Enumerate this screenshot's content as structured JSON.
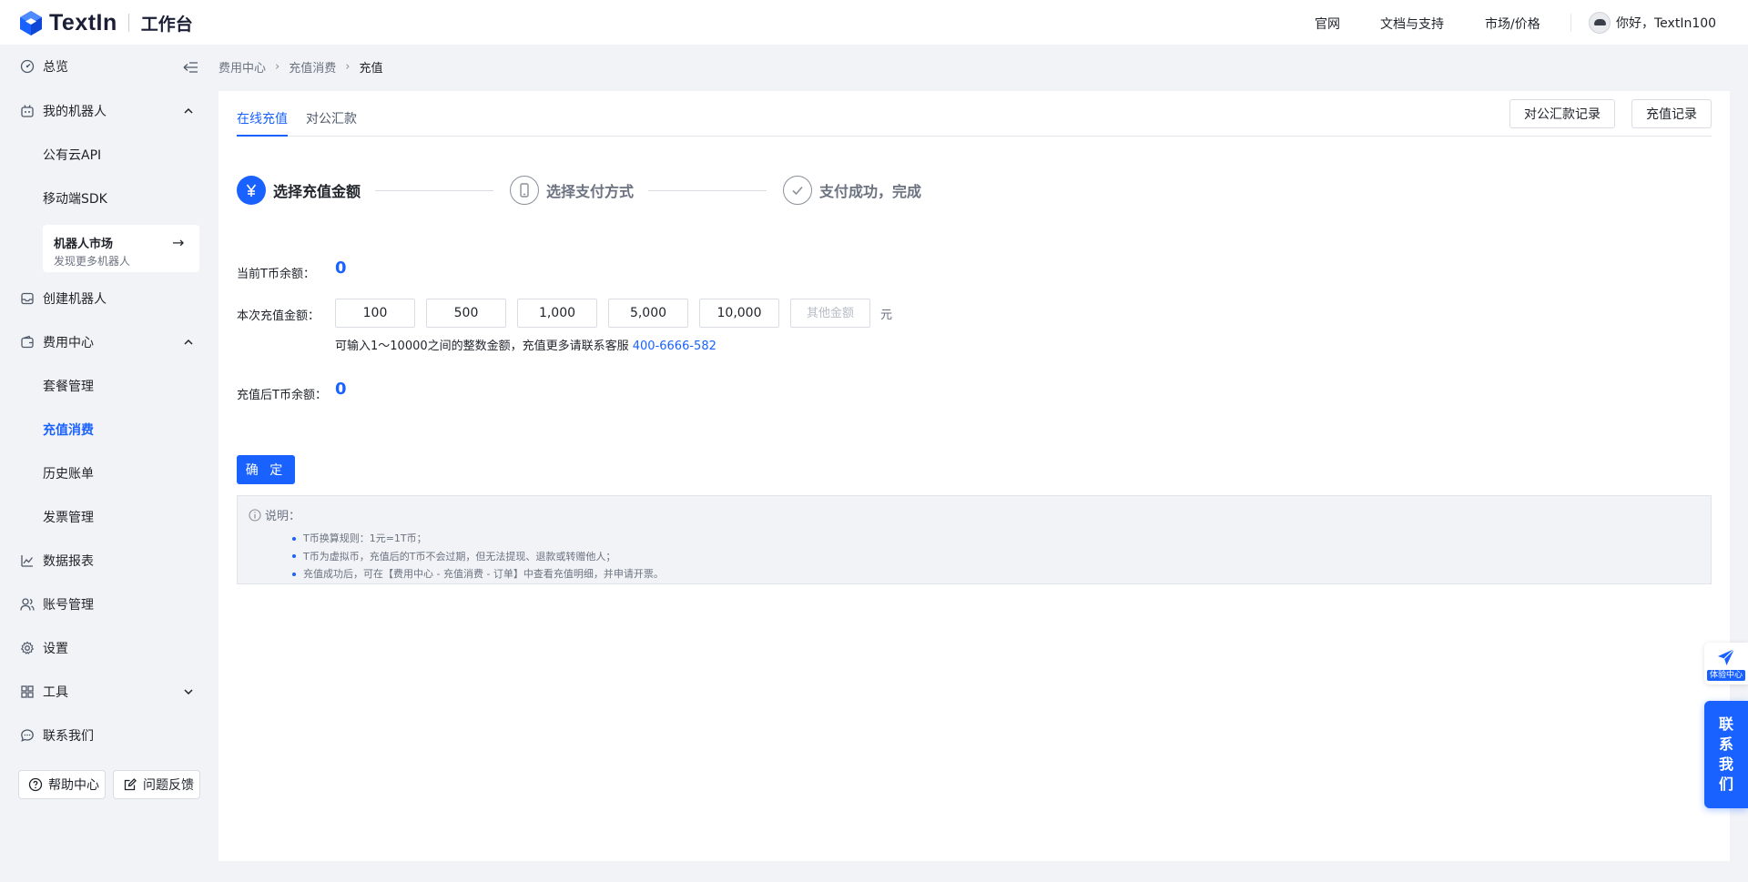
{
  "header": {
    "logo_text": "TextIn",
    "workspace": "工作台",
    "nav": [
      "官网",
      "文档与支持",
      "市场/价格"
    ],
    "user_greeting": "你好，TextIn100"
  },
  "sidebar": {
    "items": [
      {
        "label": "总览",
        "icon": "dashboard-icon"
      },
      {
        "label": "我的机器人",
        "icon": "robot-icon"
      },
      {
        "label": "公有云API"
      },
      {
        "label": "移动端SDK"
      },
      {
        "label": "创建机器人",
        "icon": "inbox-icon"
      },
      {
        "label": "费用中心",
        "icon": "wallet-icon"
      },
      {
        "label": "套餐管理"
      },
      {
        "label": "充值消费"
      },
      {
        "label": "历史账单"
      },
      {
        "label": "发票管理"
      },
      {
        "label": "数据报表",
        "icon": "chart-icon"
      },
      {
        "label": "账号管理",
        "icon": "users-icon"
      },
      {
        "label": "设置",
        "icon": "gear-icon"
      },
      {
        "label": "工具",
        "icon": "grid-icon"
      },
      {
        "label": "联系我们",
        "icon": "chat-icon"
      }
    ],
    "market": {
      "title": "机器人市场",
      "subtitle": "发现更多机器人"
    },
    "help_center": "帮助中心",
    "feedback": "问题反馈"
  },
  "breadcrumb": [
    "费用中心",
    "充值消费",
    "充值"
  ],
  "tabs": [
    "在线充值",
    "对公汇款"
  ],
  "actions": {
    "remittance_records": "对公汇款记录",
    "recharge_records": "充值记录"
  },
  "steps": [
    "选择充值金额",
    "选择支付方式",
    "支付成功，完成"
  ],
  "form": {
    "balance_label": "当前T币余额：",
    "balance_value": "0",
    "amount_label": "本次充值金额：",
    "amount_options": [
      "100",
      "500",
      "1,000",
      "5,000",
      "10,000"
    ],
    "other_placeholder": "其他金额",
    "unit": "元",
    "hint_text": "可输入1～10000之间的整数金额，充值更多请联系客服 ",
    "hint_phone": "400-6666-582",
    "after_label": "充值后T币余额：",
    "after_value": "0",
    "confirm": "确 定"
  },
  "notes": {
    "title": "说明：",
    "items": [
      "T币换算规则：1元=1T币；",
      "T币为虚拟币，充值后的T币不会过期，但无法提现、退款或转赠他人；",
      "充值成功后，可在【费用中心 - 充值消费 - 订单】中查看充值明细，并申请开票。"
    ]
  },
  "floating": {
    "experience_center": "体验中心",
    "contact_us": [
      "联",
      "系",
      "我",
      "们"
    ]
  },
  "colors": {
    "accent": "#1a62ff",
    "background": "#f1f3f7"
  }
}
